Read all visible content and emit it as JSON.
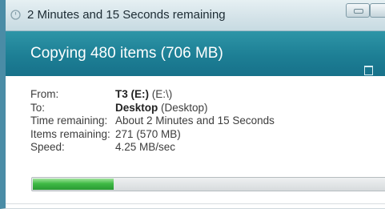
{
  "window": {
    "title": "2 Minutes and 15 Seconds remaining"
  },
  "header": {
    "title": "Copying 480 items (706 MB)"
  },
  "details": {
    "from": {
      "label": "From:",
      "name": "T3 (E:)",
      "path": "(E:\\)"
    },
    "to": {
      "label": "To:",
      "name": "Desktop",
      "path": "(Desktop)"
    },
    "time_remaining": {
      "label": "Time remaining:",
      "value": "About 2 Minutes and 15 Seconds"
    },
    "items_remaining": {
      "label": "Items remaining:",
      "value": "271 (570 MB)"
    },
    "speed": {
      "label": "Speed:",
      "value": "4.25 MB/sec"
    }
  },
  "progress": {
    "fraction": 0.23
  },
  "colors": {
    "header": "#1d7f95",
    "progress_fill": "#3fba45"
  },
  "icons": {
    "title": "stopwatch-icon",
    "minimize": "minimize-icon",
    "restore": "restore-window-icon"
  }
}
